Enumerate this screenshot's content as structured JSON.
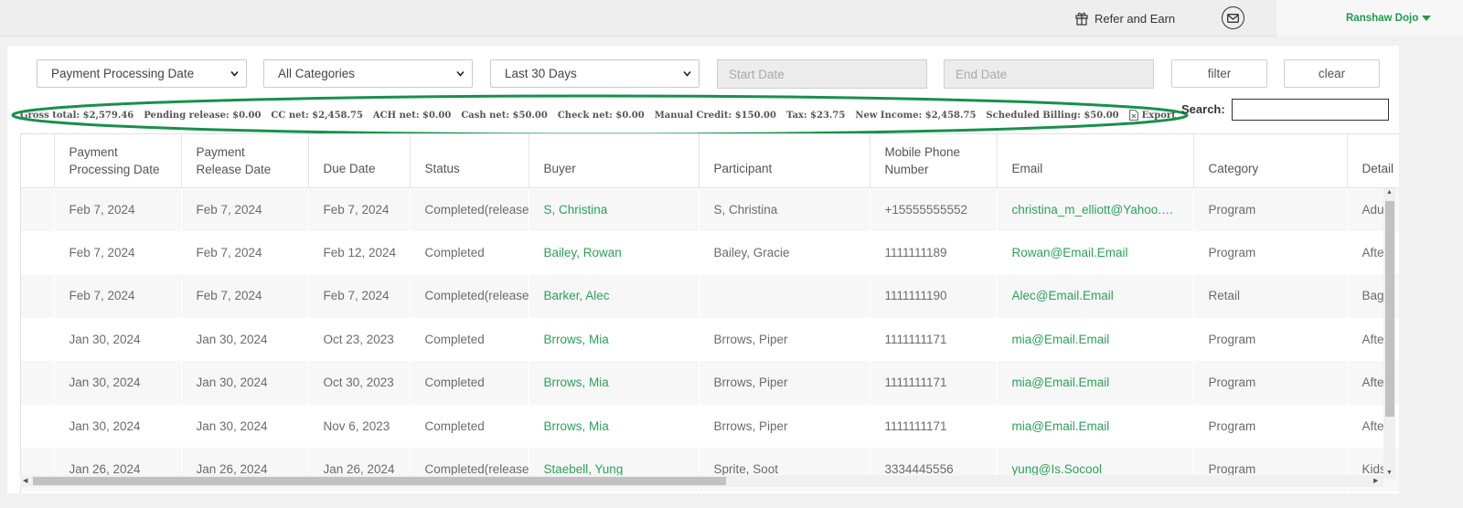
{
  "header": {
    "refer_label": "Refer and Earn",
    "user_name": "Ranshaw Dojo",
    "accent_color": "#1f9a4f"
  },
  "filters": {
    "date_type": "Payment Processing Date",
    "category": "All Categories",
    "range": "Last 30 Days",
    "start_placeholder": "Start Date",
    "end_placeholder": "End Date",
    "filter_label": "filter",
    "clear_label": "clear"
  },
  "summary": {
    "gross": "Gross total: $2,579.46",
    "pending": "Pending release: $0.00",
    "cc": "CC net: $2,458.75",
    "ach": "ACH net: $0.00",
    "cash": "Cash net: $50.00",
    "check": "Check net: $0.00",
    "manual": "Manual Credit: $150.00",
    "tax": "Tax: $23.75",
    "new_income": "New Income: $2,458.75",
    "scheduled": "Scheduled Billing: $50.00",
    "export": "Export"
  },
  "search": {
    "label": "Search:"
  },
  "table": {
    "headers": {
      "processing": [
        "Payment",
        "Processing Date"
      ],
      "release": [
        "Payment",
        "Release Date"
      ],
      "due": "Due Date",
      "status": "Status",
      "buyer": "Buyer",
      "participant": "Participant",
      "phone": [
        "Mobile Phone",
        "Number"
      ],
      "email": "Email",
      "category": "Category",
      "detail": "Detail"
    },
    "rows": [
      [
        "Feb 7, 2024",
        "Feb 7, 2024",
        "Feb 7, 2024",
        "Completed(release",
        "S, Christina",
        "S, Christina",
        "+15555555552",
        "christina_m_elliott@Yahoo.com",
        "Program",
        "Adult"
      ],
      [
        "Feb 7, 2024",
        "Feb 7, 2024",
        "Feb 12, 2024",
        "Completed",
        "Bailey, Rowan",
        "Bailey, Gracie",
        "1111111189",
        "Rowan@Email.Email",
        "Program",
        "After"
      ],
      [
        "Feb 7, 2024",
        "Feb 7, 2024",
        "Feb 7, 2024",
        "Completed(release",
        "Barker, Alec",
        "",
        "1111111190",
        "Alec@Email.Email",
        "Retail",
        "Bag"
      ],
      [
        "Jan 30, 2024",
        "Jan 30, 2024",
        "Oct 23, 2023",
        "Completed",
        "Brrows, Mia",
        "Brrows, Piper",
        "1111111171",
        "mia@Email.Email",
        "Program",
        "After"
      ],
      [
        "Jan 30, 2024",
        "Jan 30, 2024",
        "Oct 30, 2023",
        "Completed",
        "Brrows, Mia",
        "Brrows, Piper",
        "1111111171",
        "mia@Email.Email",
        "Program",
        "After"
      ],
      [
        "Jan 30, 2024",
        "Jan 30, 2024",
        "Nov 6, 2023",
        "Completed",
        "Brrows, Mia",
        "Brrows, Piper",
        "1111111171",
        "mia@Email.Email",
        "Program",
        "After"
      ],
      [
        "Jan 26, 2024",
        "Jan 26, 2024",
        "Jan 26, 2024",
        "Completed(release",
        "Staebell, Yung",
        "Sprite, Soot",
        "3334445556",
        "yung@Is.Socool",
        "Program",
        "Kids"
      ]
    ]
  }
}
